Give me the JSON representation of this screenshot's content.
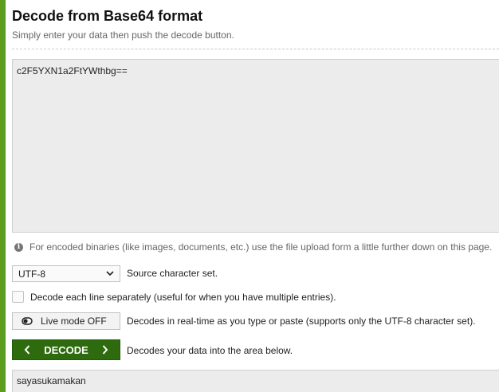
{
  "header": {
    "title": "Decode from Base64 format",
    "subtitle": "Simply enter your data then push the decode button."
  },
  "input": {
    "value": "c2F5YXN1a2FtYWthbg=="
  },
  "info": {
    "icon": "info-icon",
    "text": "For encoded binaries (like images, documents, etc.) use the file upload form a little further down on this page."
  },
  "charset": {
    "selected": "UTF-8",
    "label": "Source character set."
  },
  "each_line": {
    "checked": false,
    "label": "Decode each line separately (useful for when you have multiple entries)."
  },
  "live_mode": {
    "button_label": "Live mode OFF",
    "description": "Decodes in real-time as you type or paste (supports only the UTF-8 character set)."
  },
  "decode": {
    "button_label": "DECODE",
    "description": "Decodes your data into the area below."
  },
  "output": {
    "value": "sayasukamakan"
  },
  "colors": {
    "accent": "#5c9c1e",
    "button": "#2e6b0f"
  }
}
